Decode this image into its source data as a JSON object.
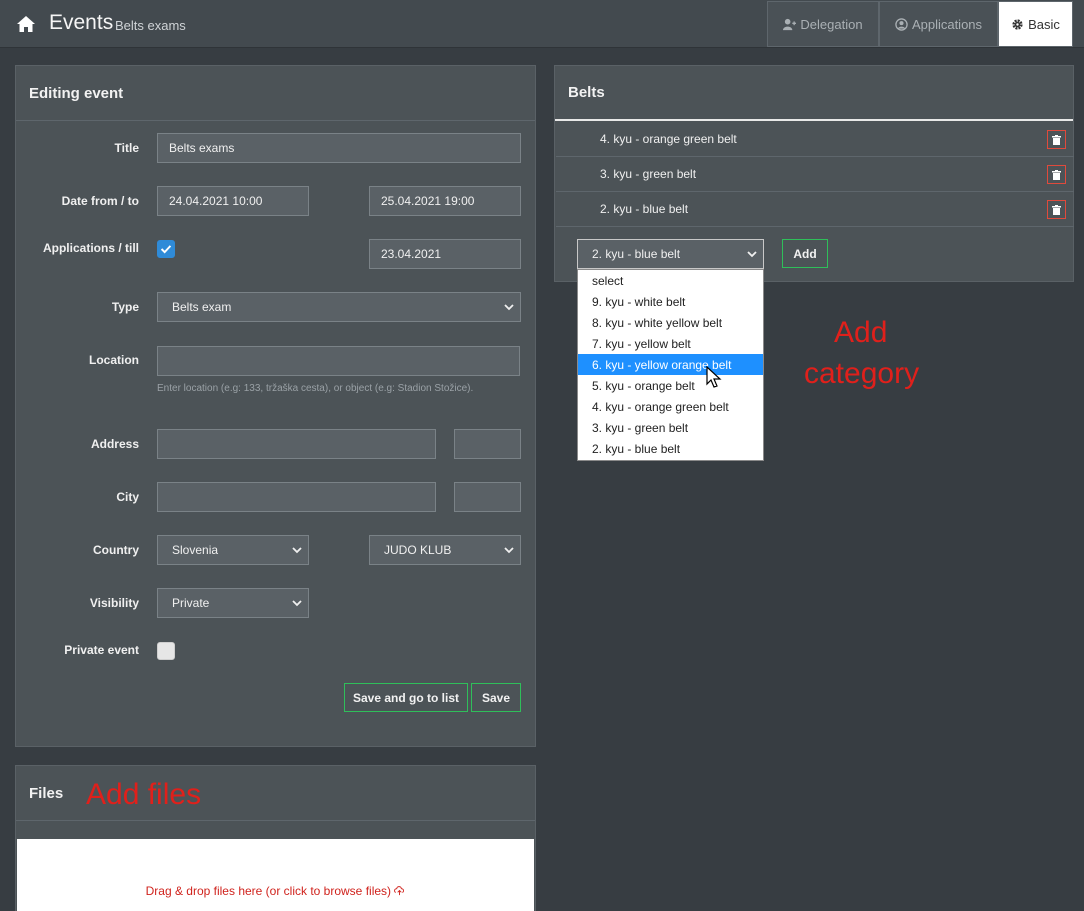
{
  "header": {
    "title": "Events",
    "subtitle": "Belts exams",
    "tabs": [
      {
        "label": "Delegation",
        "icon": "user-plus-icon"
      },
      {
        "label": "Applications",
        "icon": "user-circle-icon"
      },
      {
        "label": "Basic",
        "icon": "gear-icon"
      }
    ]
  },
  "form": {
    "heading": "Editing event",
    "title_label": "Title",
    "title_value": "Belts exams",
    "date_label": "Date from / to",
    "date_from": "24.04.2021 10:00",
    "date_to": "25.04.2021 19:00",
    "applications_label": "Applications / till",
    "applications_till": "23.04.2021",
    "type_label": "Type",
    "type_value": "Belts exam",
    "location_label": "Location",
    "location_hint": "Enter location (e.g: 133, tržaška cesta), or object (e.g: Stadion Stožice).",
    "address_label": "Address",
    "city_label": "City",
    "country_label": "Country",
    "country_value": "Slovenia",
    "club_value": "JUDO KLUB",
    "visibility_label": "Visibility",
    "visibility_value": "Private",
    "private_event_label": "Private event",
    "save_go_label": "Save and go to list",
    "save_label": "Save"
  },
  "belts": {
    "heading": "Belts",
    "items": [
      "4. kyu - orange green belt",
      "3. kyu - green belt",
      "2. kyu - blue belt"
    ],
    "selected": "2. kyu - blue belt",
    "add_label": "Add",
    "options": [
      "select",
      "9. kyu - white belt",
      "8. kyu - white yellow belt",
      "7. kyu - yellow belt",
      "6. kyu - yellow orange belt",
      "5. kyu - orange belt",
      "4. kyu - orange green belt",
      "3. kyu - green belt",
      "2. kyu - blue belt"
    ],
    "highlighted_option": "6. kyu - yellow orange belt"
  },
  "annotations": {
    "add_category_line1": "Add",
    "add_category_line2": "category",
    "add_files": "Add files"
  },
  "files": {
    "heading": "Files",
    "drop_text": "Drag & drop files here (or click to browse files)"
  },
  "colors": {
    "accent_green": "#2fbf5a",
    "highlight_blue": "#1e90ff",
    "annotation_red": "#e0201b",
    "danger": "#e04a3c"
  }
}
